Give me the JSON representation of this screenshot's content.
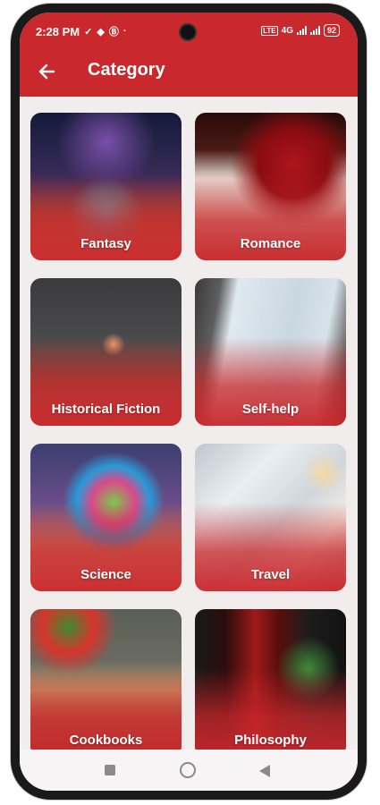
{
  "status_bar": {
    "time": "2:28 PM",
    "network": "4G",
    "battery": "92"
  },
  "app_bar": {
    "title": "Category",
    "back_icon": "arrow-left-icon"
  },
  "categories": [
    {
      "label": "Fantasy"
    },
    {
      "label": "Romance"
    },
    {
      "label": "Historical Fiction"
    },
    {
      "label": "Self-help"
    },
    {
      "label": "Science"
    },
    {
      "label": "Travel"
    },
    {
      "label": "Cookbooks"
    },
    {
      "label": "Philosophy"
    }
  ],
  "colors": {
    "primary": "#c9282c",
    "background": "#f1eded"
  },
  "nav_bar": {
    "icons": [
      "recents-square-icon",
      "home-circle-icon",
      "back-triangle-icon"
    ]
  }
}
